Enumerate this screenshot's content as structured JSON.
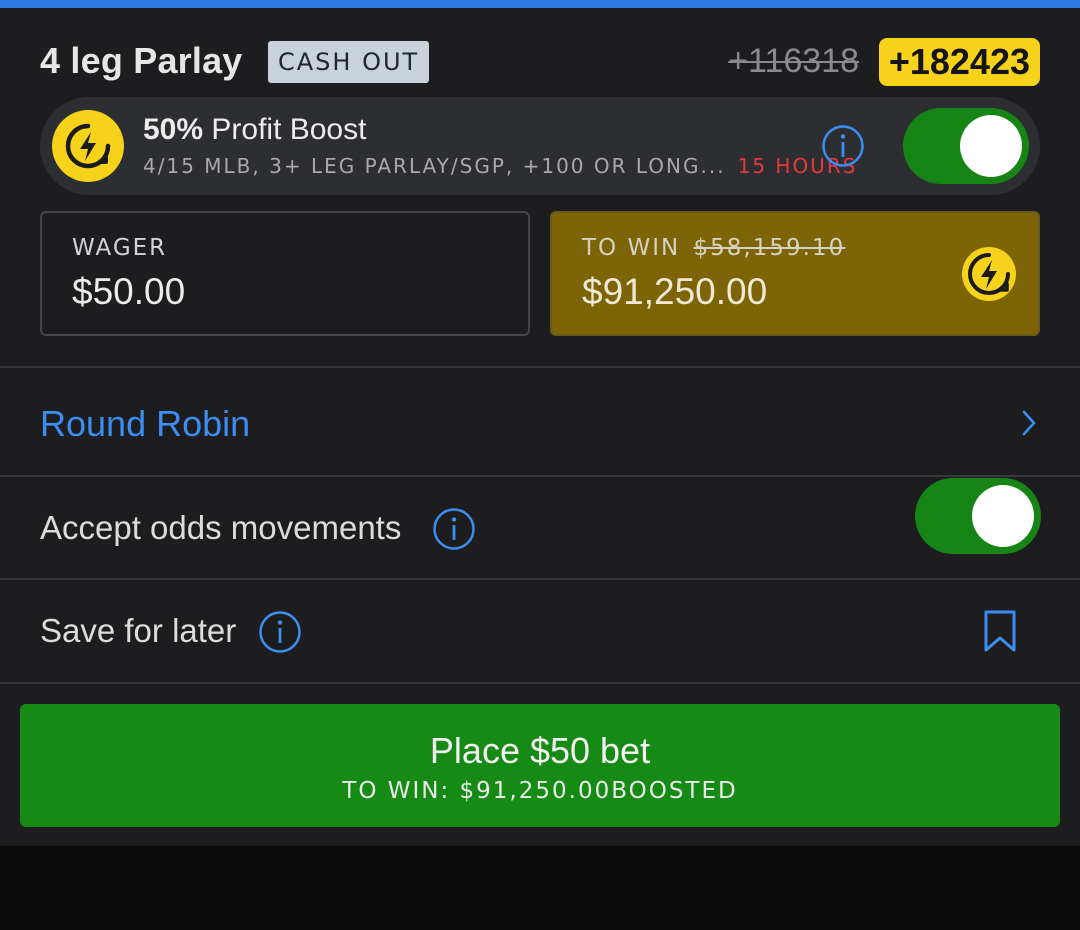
{
  "header": {
    "title": "4 leg Parlay",
    "cash_out_badge": "CASH OUT",
    "odds_original": "+116318",
    "odds_boosted": "+182423"
  },
  "boost": {
    "percent": "50%",
    "label": " Profit Boost",
    "description": "4/15 MLB, 3+ LEG PARLAY/SGP, +100 OR LONG...",
    "time_left": "15 HOURS",
    "icon": "lightning-boost-icon",
    "enabled": true
  },
  "wager": {
    "label": "WAGER",
    "value": "$50.00"
  },
  "to_win": {
    "label": "TO WIN",
    "original_value": "$58,159.10",
    "value": "$91,250.00",
    "icon": "lightning-boost-icon"
  },
  "options": {
    "round_robin": "Round Robin",
    "accept_odds": "Accept odds movements",
    "accept_odds_enabled": true,
    "save_for_later": "Save for later"
  },
  "place_bet": {
    "label": "Place $50 bet",
    "sub_label": "TO WIN: $91,250.00",
    "boosted_tag": "BOOSTED"
  },
  "colors": {
    "accent_blue": "#3c8df0",
    "boost_yellow": "#f7d21b",
    "toggle_green": "#168515",
    "place_green": "#158a14",
    "timer_red": "#e5373f"
  }
}
